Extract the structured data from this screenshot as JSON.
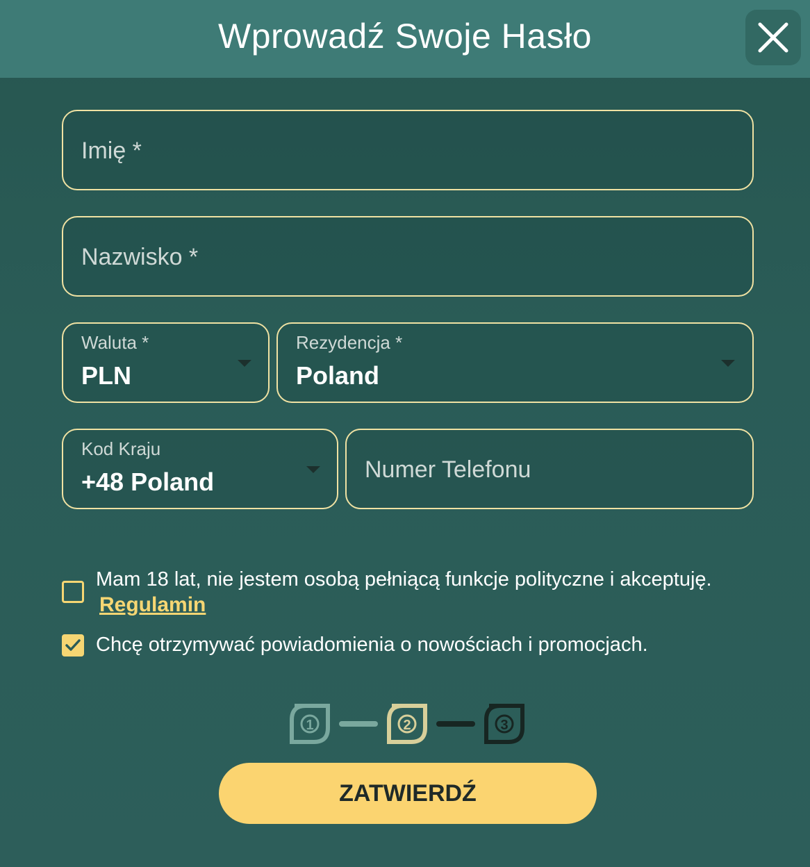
{
  "header": {
    "title": "Wprowadź Swoje Hasło"
  },
  "form": {
    "first_name": {
      "placeholder": "Imię *"
    },
    "last_name": {
      "placeholder": "Nazwisko *"
    },
    "currency": {
      "label": "Waluta *",
      "value": "PLN"
    },
    "residence": {
      "label": "Rezydencja *",
      "value": "Poland"
    },
    "country_code": {
      "label": "Kod Kraju",
      "value": "+48 Poland"
    },
    "phone": {
      "placeholder": "Numer Telefonu"
    }
  },
  "consents": {
    "terms": {
      "text": "Mam 18 lat, nie jestem osobą pełniącą funkcje polityczne i akceptuję.",
      "link": "Regulamin",
      "checked": false
    },
    "newsletter": {
      "text": "Chcę otrzymywać powiadomienia o nowościach i promocjach.",
      "checked": true
    }
  },
  "steps": {
    "items": [
      "1",
      "2",
      "3"
    ],
    "current": 3
  },
  "submit_label": "ZATWIERDŹ",
  "colors": {
    "accent": "#fbd470",
    "field_border": "#f0e2a3",
    "header_bg": "#3e7b76",
    "background": "#2a5c57"
  }
}
